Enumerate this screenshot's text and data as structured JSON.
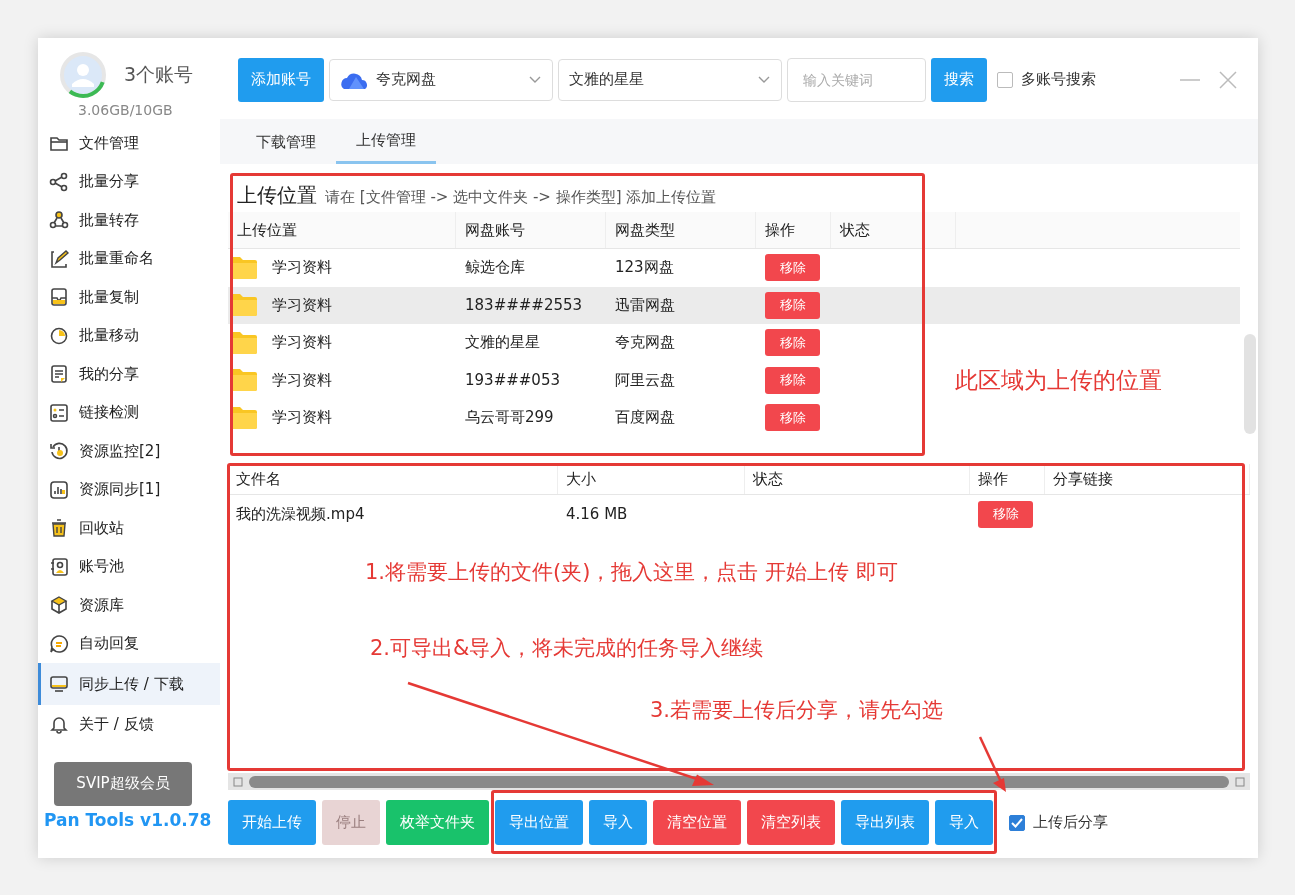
{
  "account": {
    "count": "3个账号",
    "storage": "3.06GB/10GB",
    "level": 0.3
  },
  "sidebar": {
    "items": [
      {
        "label": "文件管理",
        "selected": false
      },
      {
        "label": "批量分享",
        "selected": false
      },
      {
        "label": "批量转存",
        "selected": false
      },
      {
        "label": "批量重命名",
        "selected": false
      },
      {
        "label": "批量复制",
        "selected": false
      },
      {
        "label": "批量移动",
        "selected": false
      },
      {
        "label": "我的分享",
        "selected": false
      },
      {
        "label": "链接检测",
        "selected": false
      },
      {
        "label": "资源监控[2]",
        "selected": false
      },
      {
        "label": "资源同步[1]",
        "selected": false
      },
      {
        "label": "回收站",
        "selected": false
      },
      {
        "label": "账号池",
        "selected": false
      },
      {
        "label": "资源库",
        "selected": false
      },
      {
        "label": "自动回复",
        "selected": false
      },
      {
        "label": "同步上传 / 下载",
        "selected": true
      },
      {
        "label": "关于 / 反馈",
        "selected": false
      }
    ],
    "vip_button": "SVIP超级会员",
    "version": "Pan Tools v1.0.78"
  },
  "toolbar": {
    "add_button": "添加账号",
    "disk_select": "夸克网盘",
    "account_select": "文雅的星星",
    "search": {
      "placeholder": "输入关键词"
    },
    "search_button": "搜索",
    "multi_search": {
      "label": "多账号搜索",
      "checked": false
    }
  },
  "tabs": [
    {
      "label": "下载管理",
      "selected": false
    },
    {
      "label": "上传管理",
      "selected": true
    }
  ],
  "locations": {
    "title": "上传位置",
    "hint": "请在 [文件管理 -> 选中文件夹 -> 操作类型] 添加上传位置",
    "columns": [
      "上传位置",
      "网盘账号",
      "网盘类型",
      "操作",
      "状态"
    ],
    "rows": [
      {
        "folder": "学习资料",
        "account": "鲸选仓库",
        "disk_type": "123网盘",
        "action": "移除",
        "selected": false
      },
      {
        "folder": "学习资料",
        "account": "183####2553",
        "disk_type": "迅雷网盘",
        "action": "移除",
        "selected": true
      },
      {
        "folder": "学习资料",
        "account": "文雅的星星",
        "disk_type": "夸克网盘",
        "action": "移除",
        "selected": false
      },
      {
        "folder": "学习资料",
        "account": "193###053",
        "disk_type": "阿里云盘",
        "action": "移除",
        "selected": false
      },
      {
        "folder": "学习资料",
        "account": "乌云哥哥299",
        "disk_type": "百度网盘",
        "action": "移除",
        "selected": false
      }
    ]
  },
  "files": {
    "columns": [
      "文件名",
      "大小",
      "状态",
      "操作",
      "分享链接"
    ],
    "rows": [
      {
        "name": "我的洗澡视频.mp4",
        "size": "4.16 MB",
        "action": "移除"
      }
    ]
  },
  "buttons": [
    {
      "label": "开始上传",
      "kind": "primary"
    },
    {
      "label": "停止",
      "kind": "disabled"
    },
    {
      "label": "枚举文件夹",
      "kind": "success"
    },
    {
      "label": "导出位置",
      "kind": "primary"
    },
    {
      "label": "导入",
      "kind": "primary"
    },
    {
      "label": "清空位置",
      "kind": "danger"
    },
    {
      "label": "清空列表",
      "kind": "danger"
    },
    {
      "label": "导出列表",
      "kind": "primary"
    },
    {
      "label": "导入",
      "kind": "primary"
    }
  ],
  "share_after_upload": {
    "label": "上传后分享",
    "checked": true
  },
  "notes": [
    "此区域为上传的位置",
    "1.将需要上传的文件(夹)，拖入这里，点击 开始上传 即可",
    "2.可导出&导入，将未完成的任务导入继续",
    "3.若需要上传后分享，请先勾选"
  ]
}
